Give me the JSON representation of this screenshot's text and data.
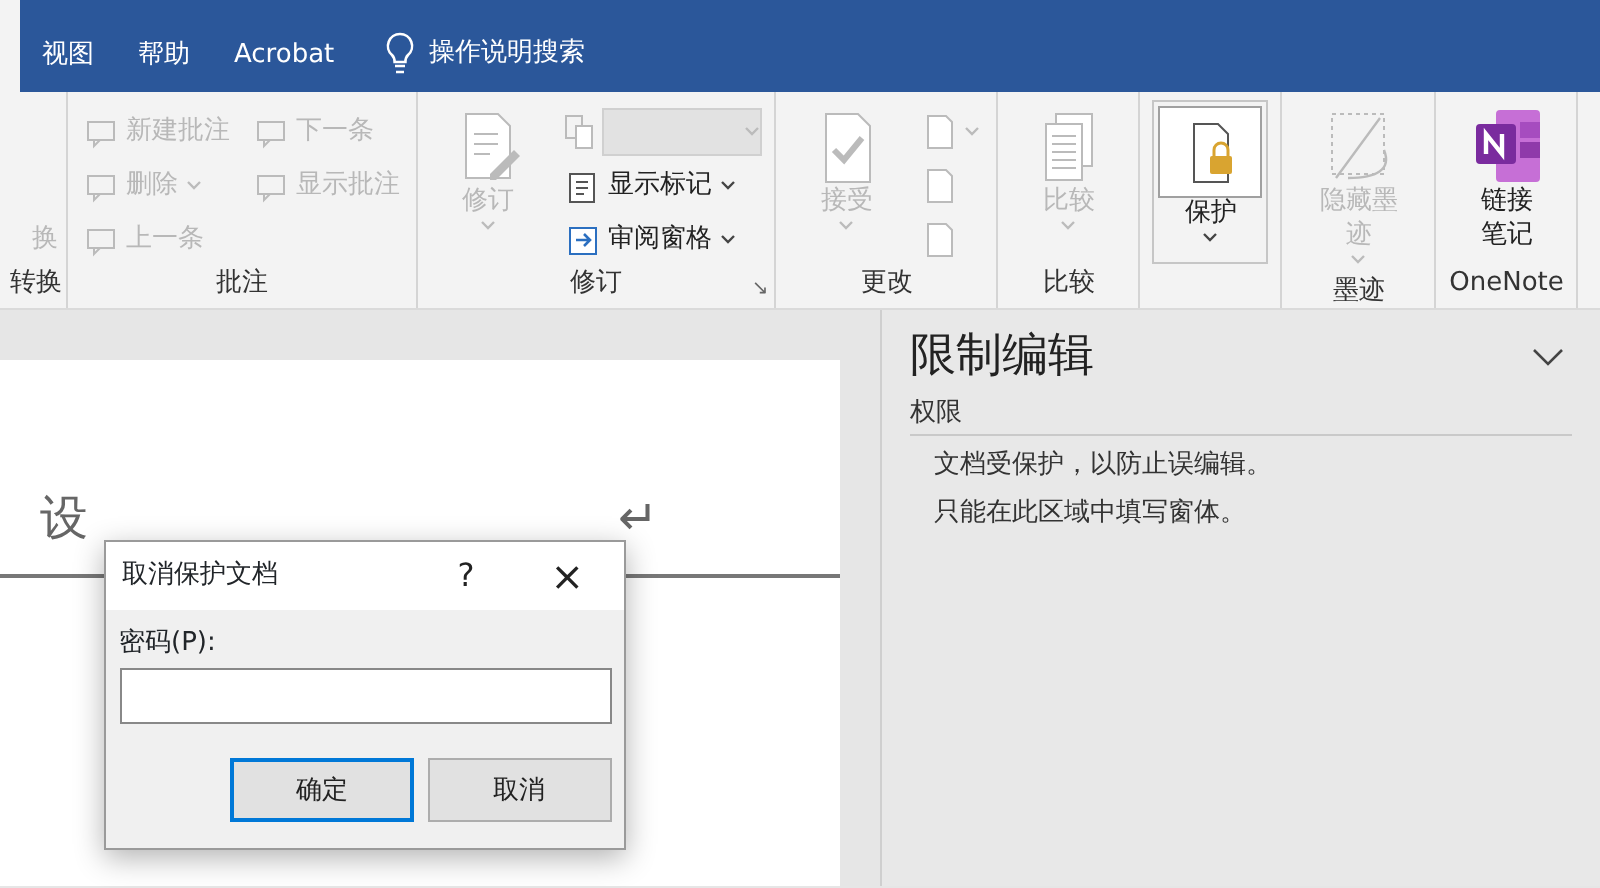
{
  "tabs": [
    {
      "label": "视图",
      "selected": false
    },
    {
      "label": "帮助",
      "selected": false
    },
    {
      "label": "Acrobat",
      "selected": false
    }
  ],
  "tell_me": {
    "label": "操作说明搜索"
  },
  "ribbon": [
    {
      "label": "转换",
      "columns": [
        {
          "kind": "small",
          "items": [
            {
              "text": "换",
              "disabled": true,
              "dropdown": false
            }
          ]
        }
      ]
    },
    {
      "label": "批注",
      "columns": [
        {
          "kind": "small",
          "items": [
            {
              "text": "新建批注",
              "disabled": true,
              "dropdown": false
            },
            {
              "text": "删除",
              "disabled": true,
              "dropdown": true
            },
            {
              "text": "上一条",
              "disabled": true,
              "dropdown": false
            }
          ]
        },
        {
          "kind": "small",
          "items": [
            {
              "text": "下一条",
              "disabled": true,
              "dropdown": false
            },
            {
              "text": "显示批注",
              "disabled": true,
              "dropdown": false
            }
          ]
        }
      ]
    },
    {
      "label": "修订",
      "launcher": "↘",
      "columns": [
        {
          "kind": "large",
          "text": "修订",
          "disabled": true,
          "dropdown": true,
          "selected": false
        },
        {
          "kind": "small",
          "items": [
            {
              "kind": "combo",
              "disabled": true
            },
            {
              "text": "显示标记",
              "disabled": false,
              "dropdown": true
            },
            {
              "text": "审阅窗格",
              "disabled": false,
              "dropdown": true
            }
          ]
        }
      ]
    },
    {
      "label": "更改",
      "columns": [
        {
          "kind": "large",
          "text": "接受",
          "disabled": true,
          "dropdown": true,
          "selected": false
        },
        {
          "kind": "small",
          "items": [
            {
              "disabled": true,
              "dropdown": true
            },
            {
              "disabled": true,
              "dropdown": false
            },
            {
              "disabled": true,
              "dropdown": false
            }
          ]
        }
      ]
    },
    {
      "label": "比较",
      "columns": [
        {
          "kind": "large",
          "text": "比较",
          "disabled": true,
          "dropdown": true,
          "selected": false
        }
      ]
    },
    {
      "columns": [
        {
          "kind": "large",
          "text": "保护",
          "disabled": false,
          "dropdown": true,
          "selected": true
        }
      ]
    },
    {
      "label": "墨迹",
      "columns": [
        {
          "kind": "large",
          "text": "隐藏墨迹",
          "disabled": true,
          "dropdown": true,
          "selected": false
        }
      ]
    },
    {
      "label": "OneNote",
      "columns": [
        {
          "kind": "large",
          "text": "链接笔记",
          "disabled": false,
          "dropdown": false,
          "selected": false
        }
      ]
    }
  ],
  "document": {
    "visible_text": [
      "设",
      "↵"
    ]
  },
  "dialog": {
    "title": "取消保护文档",
    "help": "?",
    "close": "×",
    "field_label": "密码(P):",
    "focused": true,
    "buttons": [
      {
        "label": "确定",
        "default": true
      },
      {
        "label": "取消",
        "default": false
      }
    ]
  },
  "pane": {
    "title": "限制编辑",
    "section": "权限",
    "lines": [
      "文档受保护，以防止误编辑。",
      "只能在此区域中填写窗体。"
    ]
  }
}
